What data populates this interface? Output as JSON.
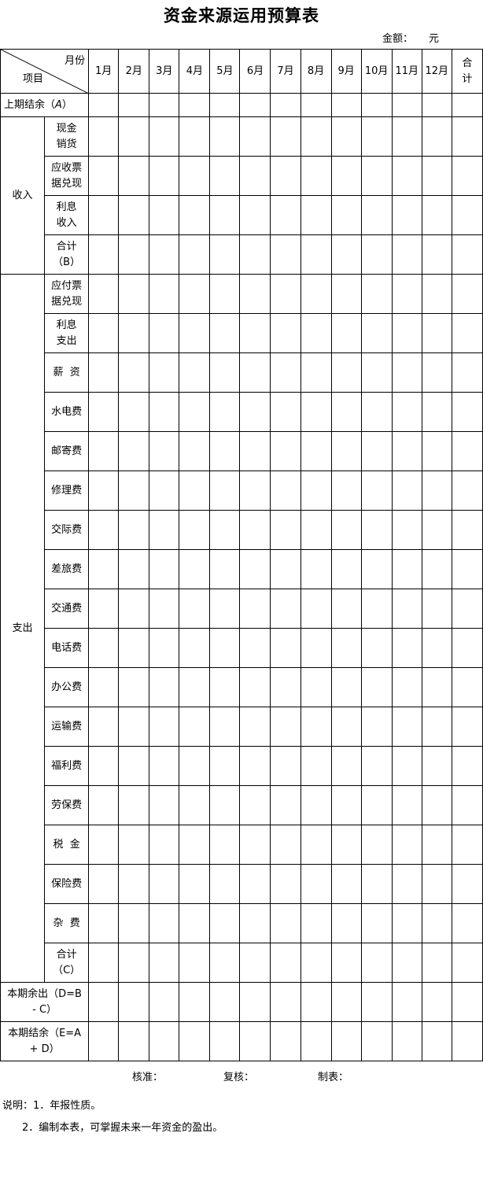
{
  "title": "资金来源运用预算表",
  "amount_label": "金额：",
  "amount_unit": "元",
  "header": {
    "month_label": "月份",
    "item_label": "项目",
    "months": [
      "1月",
      "2月",
      "3月",
      "4月",
      "5月",
      "6月",
      "7月",
      "8月",
      "9月",
      "10月",
      "11月",
      "12月"
    ],
    "total_line1": "合",
    "total_line2": "计"
  },
  "rows": {
    "prev_balance_text": "上期结余（",
    "prev_balance_var": "A",
    "prev_balance_close": "）",
    "income_group": "收入",
    "income_items": [
      {
        "l1": "现金",
        "l2": "销货"
      },
      {
        "l1": "应收票",
        "l2": "据兑现"
      },
      {
        "l1": "利息",
        "l2": "收入"
      },
      {
        "l1": "合计",
        "l2": "（B）"
      }
    ],
    "expense_group": "支出",
    "expense_two_line": [
      {
        "l1": "应付票",
        "l2": "据兑现"
      },
      {
        "l1": "利息",
        "l2": "支出"
      }
    ],
    "expense_items": [
      "薪  资",
      "水电费",
      "邮寄费",
      "修理费",
      "交际费",
      "差旅费",
      "交通费",
      "电话费",
      "办公费",
      "运输费",
      "福利费",
      "劳保费",
      "税  金",
      "保险费",
      "杂  费"
    ],
    "expense_total_l1": "合计",
    "expense_total_l2": "（C）",
    "surplus_l1": "本期余出（D=B",
    "surplus_l2": "- C）",
    "ending_l1": "本期结余（E=A",
    "ending_l2": "+ D）"
  },
  "signatures": {
    "approve": "核准：",
    "review": "复核：",
    "prepare": "制表："
  },
  "notes": {
    "line1": "说明：1．年报性质。",
    "line2": "2．编制本表，可掌握未来一年资金的盈出。"
  }
}
